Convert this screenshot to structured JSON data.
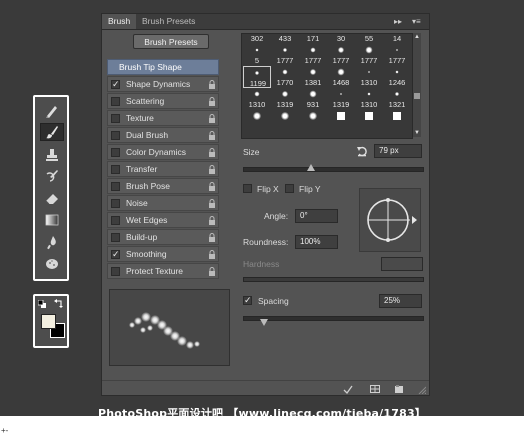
{
  "tabs": [
    "Brush",
    "Brush Presets"
  ],
  "tab_controls": {
    "collapse": "▸▸",
    "menu": "▾≡"
  },
  "brush_presets_button": "Brush Presets",
  "options": [
    {
      "label": "Brush Tip Shape",
      "selected": true,
      "checked": false,
      "lock": false
    },
    {
      "label": "Shape Dynamics",
      "checked": true,
      "lock": true
    },
    {
      "label": "Scattering",
      "checked": false,
      "lock": true
    },
    {
      "label": "Texture",
      "checked": false,
      "lock": true
    },
    {
      "label": "Dual Brush",
      "checked": false,
      "lock": true
    },
    {
      "label": "Color Dynamics",
      "checked": false,
      "lock": true
    },
    {
      "label": "Transfer",
      "checked": false,
      "lock": true
    },
    {
      "label": "Brush Pose",
      "checked": false,
      "lock": true
    },
    {
      "label": "Noise",
      "checked": false,
      "lock": true
    },
    {
      "label": "Wet Edges",
      "checked": false,
      "lock": true
    },
    {
      "label": "Build-up",
      "checked": false,
      "lock": true
    },
    {
      "label": "Smoothing",
      "checked": true,
      "lock": true
    },
    {
      "label": "Protect Texture",
      "checked": false,
      "lock": true
    }
  ],
  "brush_grid": {
    "rows": [
      [
        "302",
        "433",
        "171",
        "30",
        "55",
        "14"
      ],
      [
        "5",
        "1777",
        "1777",
        "1777",
        "1777",
        "1777"
      ],
      [
        "1199",
        "1770",
        "1381",
        "1468",
        "1310",
        "1246"
      ],
      [
        "1310",
        "1319",
        "931",
        "1319",
        "1310",
        "1321"
      ],
      [
        "",
        "",
        "",
        "",
        "",
        ""
      ]
    ],
    "selected": [
      2,
      0
    ]
  },
  "size": {
    "label": "Size",
    "value": "79 px",
    "slider_fraction": 0.38
  },
  "flip_x": {
    "label": "Flip X",
    "checked": false
  },
  "flip_y": {
    "label": "Flip Y",
    "checked": false
  },
  "angle": {
    "label": "Angle:",
    "value": "0°"
  },
  "roundness": {
    "label": "Roundness:",
    "value": "100%"
  },
  "hardness": {
    "label": "Hardness",
    "value": ""
  },
  "spacing": {
    "label": "Spacing",
    "checked": true,
    "value": "25%",
    "slider_fraction": 0.12
  },
  "watermark": "PhotoShop平面设计吧 【www.linecg.com/tieba/1783】",
  "corner_mark": "+-"
}
